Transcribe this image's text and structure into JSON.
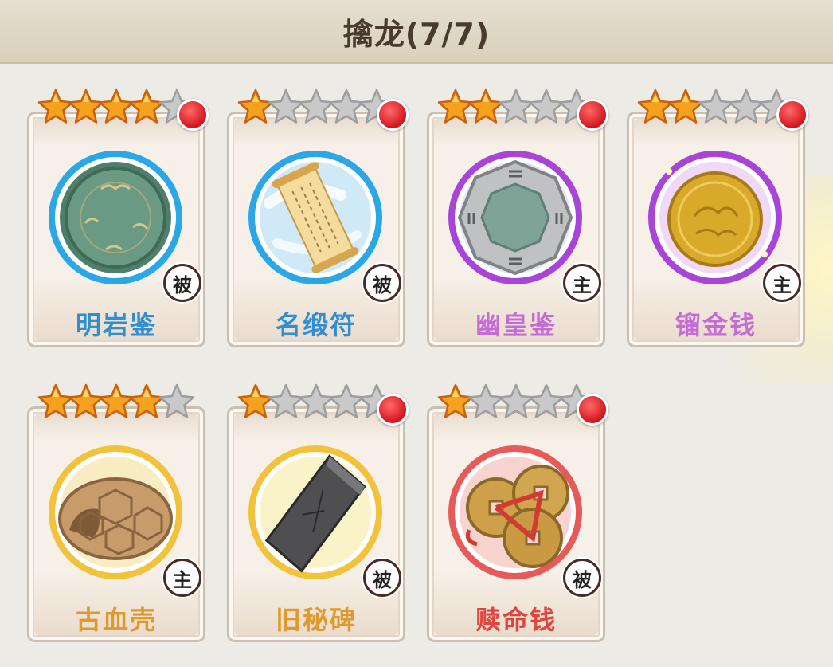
{
  "header": {
    "title": "擒龙(7/7)"
  },
  "cards": [
    {
      "name": "明岩鉴",
      "stars": 4,
      "max_stars": 5,
      "tag": "被",
      "rarity_color": "#2f8fd0",
      "ring_color": "#2aa7e6",
      "icon": "jade-mirror-icon",
      "has_badge": true
    },
    {
      "name": "名缎符",
      "stars": 1,
      "max_stars": 5,
      "tag": "被",
      "rarity_color": "#2f8fd0",
      "ring_color": "#2aa7e6",
      "icon": "scroll-talisman-icon",
      "has_badge": true
    },
    {
      "name": "幽皇鉴",
      "stars": 2,
      "max_stars": 5,
      "tag": "主",
      "rarity_color": "#c56bd8",
      "ring_color": "#a845d8",
      "icon": "bagua-mirror-icon",
      "has_badge": true
    },
    {
      "name": "镏金钱",
      "stars": 2,
      "max_stars": 5,
      "tag": "主",
      "rarity_color": "#c56bd8",
      "ring_color": "#a845d8",
      "icon": "gold-coin-icon",
      "has_badge": true
    },
    {
      "name": "古血壳",
      "stars": 4,
      "max_stars": 5,
      "tag": "主",
      "rarity_color": "#e09a2c",
      "ring_color": "#f2c23a",
      "icon": "tortoise-shell-icon",
      "has_badge": false
    },
    {
      "name": "旧秘碑",
      "stars": 1,
      "max_stars": 5,
      "tag": "被",
      "rarity_color": "#e09a2c",
      "ring_color": "#f2c23a",
      "icon": "stone-tablet-icon",
      "has_badge": true
    },
    {
      "name": "赎命钱",
      "stars": 1,
      "max_stars": 5,
      "tag": "被",
      "rarity_color": "#e0443c",
      "ring_color": "#e85a5a",
      "icon": "copper-coins-icon",
      "has_badge": true
    }
  ]
}
